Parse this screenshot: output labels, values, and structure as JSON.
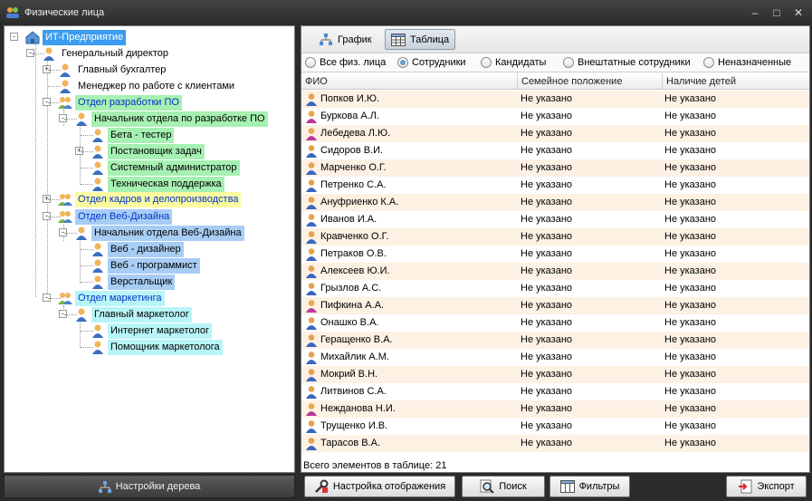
{
  "window": {
    "title": "Физические лица"
  },
  "tree": {
    "nodes": [
      {
        "label": "ИТ-Предприятие",
        "icon": "building-icon",
        "bg": "#3c9cf0",
        "fg": "#ffffff"
      },
      {
        "label": "Генеральный директор",
        "icon": "person-icon",
        "bg": "",
        "fg": "#000000"
      },
      {
        "label": "Главный бухгалтер",
        "icon": "person-icon",
        "bg": "",
        "fg": "#000000"
      },
      {
        "label": "Менеджер по работе с клиентами",
        "icon": "person-icon",
        "bg": "",
        "fg": "#000000"
      },
      {
        "label": "Отдел разработки ПО",
        "icon": "group-icon",
        "bg": "#a6f0b2",
        "fg": "#0033cc"
      },
      {
        "label": "Начальник отдела по разработке ПО",
        "icon": "person-icon",
        "bg": "#a6f0b2",
        "fg": "#000000"
      },
      {
        "label": "Бета - тестер",
        "icon": "person-icon",
        "bg": "#a6f0b2",
        "fg": "#000000"
      },
      {
        "label": "Постановщик задач",
        "icon": "person-icon",
        "bg": "#a6f0b2",
        "fg": "#000000"
      },
      {
        "label": "Системный администратор",
        "icon": "person-icon",
        "bg": "#a6f0b2",
        "fg": "#000000"
      },
      {
        "label": "Техническая поддержка",
        "icon": "person-icon",
        "bg": "#a6f0b2",
        "fg": "#000000"
      },
      {
        "label": "Отдел кадров и делопроизводства",
        "icon": "group-icon",
        "bg": "#fafaa0",
        "fg": "#0033cc"
      },
      {
        "label": "Отдел Веб-Дизайна",
        "icon": "group-icon",
        "bg": "#a8cdf5",
        "fg": "#0033cc"
      },
      {
        "label": "Начальник отдела Веб-Дизайна",
        "icon": "person-icon",
        "bg": "#a8cdf5",
        "fg": "#000000"
      },
      {
        "label": "Веб - дизайнер",
        "icon": "person-icon",
        "bg": "#a8cdf5",
        "fg": "#000000"
      },
      {
        "label": "Веб - программист",
        "icon": "person-icon",
        "bg": "#a8cdf5",
        "fg": "#000000"
      },
      {
        "label": "Верстальщик",
        "icon": "person-icon",
        "bg": "#a8cdf5",
        "fg": "#000000"
      },
      {
        "label": "Отдел маркетинга",
        "icon": "group-icon",
        "bg": "#b8f5f8",
        "fg": "#0033cc"
      },
      {
        "label": "Главный маркетолог",
        "icon": "person-icon",
        "bg": "#b8f5f8",
        "fg": "#000000"
      },
      {
        "label": "Интернет маркетолог",
        "icon": "person-icon",
        "bg": "#b8f5f8",
        "fg": "#000000"
      },
      {
        "label": "Помощник маркетолога",
        "icon": "person-icon",
        "bg": "#b8f5f8",
        "fg": "#000000"
      }
    ],
    "settings_label": "Настройки дерева"
  },
  "tabs": {
    "chart_label": "График",
    "table_label": "Таблица"
  },
  "filters": {
    "options": [
      "Все физ. лица",
      "Сотрудники",
      "Кандидаты",
      "Внештатные сотрудники",
      "Неназначенные"
    ],
    "selected": "Сотрудники"
  },
  "table": {
    "columns": [
      "ФИО",
      "Семейное положение",
      "Наличие детей"
    ],
    "rows": [
      {
        "name": "Попков И.Ю.",
        "gender": "m",
        "marital": "Не указано",
        "children": "Не указано"
      },
      {
        "name": "Буркова А.Л.",
        "gender": "f",
        "marital": "Не указано",
        "children": "Не указано"
      },
      {
        "name": "Лебедева Л.Ю.",
        "gender": "f",
        "marital": "Не указано",
        "children": "Не указано"
      },
      {
        "name": "Сидоров В.И.",
        "gender": "m",
        "marital": "Не указано",
        "children": "Не указано"
      },
      {
        "name": "Марченко О.Г.",
        "gender": "m",
        "marital": "Не указано",
        "children": "Не указано"
      },
      {
        "name": "Петренко С.А.",
        "gender": "m",
        "marital": "Не указано",
        "children": "Не указано"
      },
      {
        "name": "Ануфриенко К.А.",
        "gender": "m",
        "marital": "Не указано",
        "children": "Не указано"
      },
      {
        "name": "Иванов И.А.",
        "gender": "m",
        "marital": "Не указано",
        "children": "Не указано"
      },
      {
        "name": "Кравченко О.Г.",
        "gender": "m",
        "marital": "Не указано",
        "children": "Не указано"
      },
      {
        "name": "Петраков О.В.",
        "gender": "m",
        "marital": "Не указано",
        "children": "Не указано"
      },
      {
        "name": "Алексеев Ю.И.",
        "gender": "m",
        "marital": "Не указано",
        "children": "Не указано"
      },
      {
        "name": "Грызлов А.С.",
        "gender": "m",
        "marital": "Не указано",
        "children": "Не указано"
      },
      {
        "name": "Пифкина А.А.",
        "gender": "f",
        "marital": "Не указано",
        "children": "Не указано"
      },
      {
        "name": "Онашко В.А.",
        "gender": "m",
        "marital": "Не указано",
        "children": "Не указано"
      },
      {
        "name": "Геращенко В.А.",
        "gender": "m",
        "marital": "Не указано",
        "children": "Не указано"
      },
      {
        "name": "Михайлик А.М.",
        "gender": "m",
        "marital": "Не указано",
        "children": "Не указано"
      },
      {
        "name": "Мокрий В.Н.",
        "gender": "m",
        "marital": "Не указано",
        "children": "Не указано"
      },
      {
        "name": "Литвинов С.А.",
        "gender": "m",
        "marital": "Не указано",
        "children": "Не указано"
      },
      {
        "name": "Нежданова Н.И.",
        "gender": "f",
        "marital": "Не указано",
        "children": "Не указано"
      },
      {
        "name": "Трущенко И.В.",
        "gender": "m",
        "marital": "Не указано",
        "children": "Не указано"
      },
      {
        "name": "Тарасов В.А.",
        "gender": "m",
        "marital": "Не указано",
        "children": "Не указано"
      }
    ],
    "status": "Всего элементов в таблице: 21"
  },
  "toolbar": {
    "display_settings_label": "Настройка отображения",
    "search_label": "Поиск",
    "filters_label": "Фильтры",
    "export_label": "Экспорт"
  }
}
